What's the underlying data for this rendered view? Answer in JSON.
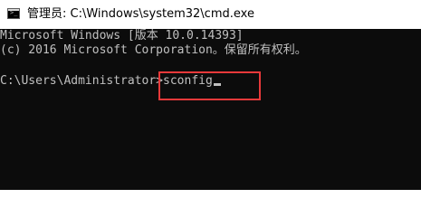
{
  "window": {
    "title": "管理员: C:\\Windows\\system32\\cmd.exe",
    "icon": "cmd-icon"
  },
  "console": {
    "line1": "Microsoft Windows [版本 10.0.14393]",
    "line2": "(c) 2016 Microsoft Corporation。保留所有权利。",
    "prompt": "C:\\Users\\Administrator>",
    "command": "sconfig"
  },
  "colors": {
    "console_bg": "#0c0c0c",
    "console_text": "#c0c0c0",
    "highlight": "#e8393a"
  }
}
